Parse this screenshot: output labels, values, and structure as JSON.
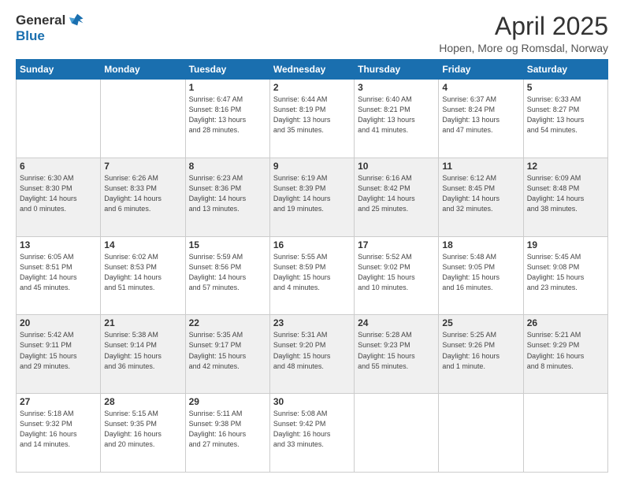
{
  "header": {
    "logo_general": "General",
    "logo_blue": "Blue",
    "month_title": "April 2025",
    "location": "Hopen, More og Romsdal, Norway"
  },
  "weekdays": [
    "Sunday",
    "Monday",
    "Tuesday",
    "Wednesday",
    "Thursday",
    "Friday",
    "Saturday"
  ],
  "weeks": [
    [
      {
        "day": "",
        "info": ""
      },
      {
        "day": "",
        "info": ""
      },
      {
        "day": "1",
        "info": "Sunrise: 6:47 AM\nSunset: 8:16 PM\nDaylight: 13 hours\nand 28 minutes."
      },
      {
        "day": "2",
        "info": "Sunrise: 6:44 AM\nSunset: 8:19 PM\nDaylight: 13 hours\nand 35 minutes."
      },
      {
        "day": "3",
        "info": "Sunrise: 6:40 AM\nSunset: 8:21 PM\nDaylight: 13 hours\nand 41 minutes."
      },
      {
        "day": "4",
        "info": "Sunrise: 6:37 AM\nSunset: 8:24 PM\nDaylight: 13 hours\nand 47 minutes."
      },
      {
        "day": "5",
        "info": "Sunrise: 6:33 AM\nSunset: 8:27 PM\nDaylight: 13 hours\nand 54 minutes."
      }
    ],
    [
      {
        "day": "6",
        "info": "Sunrise: 6:30 AM\nSunset: 8:30 PM\nDaylight: 14 hours\nand 0 minutes."
      },
      {
        "day": "7",
        "info": "Sunrise: 6:26 AM\nSunset: 8:33 PM\nDaylight: 14 hours\nand 6 minutes."
      },
      {
        "day": "8",
        "info": "Sunrise: 6:23 AM\nSunset: 8:36 PM\nDaylight: 14 hours\nand 13 minutes."
      },
      {
        "day": "9",
        "info": "Sunrise: 6:19 AM\nSunset: 8:39 PM\nDaylight: 14 hours\nand 19 minutes."
      },
      {
        "day": "10",
        "info": "Sunrise: 6:16 AM\nSunset: 8:42 PM\nDaylight: 14 hours\nand 25 minutes."
      },
      {
        "day": "11",
        "info": "Sunrise: 6:12 AM\nSunset: 8:45 PM\nDaylight: 14 hours\nand 32 minutes."
      },
      {
        "day": "12",
        "info": "Sunrise: 6:09 AM\nSunset: 8:48 PM\nDaylight: 14 hours\nand 38 minutes."
      }
    ],
    [
      {
        "day": "13",
        "info": "Sunrise: 6:05 AM\nSunset: 8:51 PM\nDaylight: 14 hours\nand 45 minutes."
      },
      {
        "day": "14",
        "info": "Sunrise: 6:02 AM\nSunset: 8:53 PM\nDaylight: 14 hours\nand 51 minutes."
      },
      {
        "day": "15",
        "info": "Sunrise: 5:59 AM\nSunset: 8:56 PM\nDaylight: 14 hours\nand 57 minutes."
      },
      {
        "day": "16",
        "info": "Sunrise: 5:55 AM\nSunset: 8:59 PM\nDaylight: 15 hours\nand 4 minutes."
      },
      {
        "day": "17",
        "info": "Sunrise: 5:52 AM\nSunset: 9:02 PM\nDaylight: 15 hours\nand 10 minutes."
      },
      {
        "day": "18",
        "info": "Sunrise: 5:48 AM\nSunset: 9:05 PM\nDaylight: 15 hours\nand 16 minutes."
      },
      {
        "day": "19",
        "info": "Sunrise: 5:45 AM\nSunset: 9:08 PM\nDaylight: 15 hours\nand 23 minutes."
      }
    ],
    [
      {
        "day": "20",
        "info": "Sunrise: 5:42 AM\nSunset: 9:11 PM\nDaylight: 15 hours\nand 29 minutes."
      },
      {
        "day": "21",
        "info": "Sunrise: 5:38 AM\nSunset: 9:14 PM\nDaylight: 15 hours\nand 36 minutes."
      },
      {
        "day": "22",
        "info": "Sunrise: 5:35 AM\nSunset: 9:17 PM\nDaylight: 15 hours\nand 42 minutes."
      },
      {
        "day": "23",
        "info": "Sunrise: 5:31 AM\nSunset: 9:20 PM\nDaylight: 15 hours\nand 48 minutes."
      },
      {
        "day": "24",
        "info": "Sunrise: 5:28 AM\nSunset: 9:23 PM\nDaylight: 15 hours\nand 55 minutes."
      },
      {
        "day": "25",
        "info": "Sunrise: 5:25 AM\nSunset: 9:26 PM\nDaylight: 16 hours\nand 1 minute."
      },
      {
        "day": "26",
        "info": "Sunrise: 5:21 AM\nSunset: 9:29 PM\nDaylight: 16 hours\nand 8 minutes."
      }
    ],
    [
      {
        "day": "27",
        "info": "Sunrise: 5:18 AM\nSunset: 9:32 PM\nDaylight: 16 hours\nand 14 minutes."
      },
      {
        "day": "28",
        "info": "Sunrise: 5:15 AM\nSunset: 9:35 PM\nDaylight: 16 hours\nand 20 minutes."
      },
      {
        "day": "29",
        "info": "Sunrise: 5:11 AM\nSunset: 9:38 PM\nDaylight: 16 hours\nand 27 minutes."
      },
      {
        "day": "30",
        "info": "Sunrise: 5:08 AM\nSunset: 9:42 PM\nDaylight: 16 hours\nand 33 minutes."
      },
      {
        "day": "",
        "info": ""
      },
      {
        "day": "",
        "info": ""
      },
      {
        "day": "",
        "info": ""
      }
    ]
  ]
}
